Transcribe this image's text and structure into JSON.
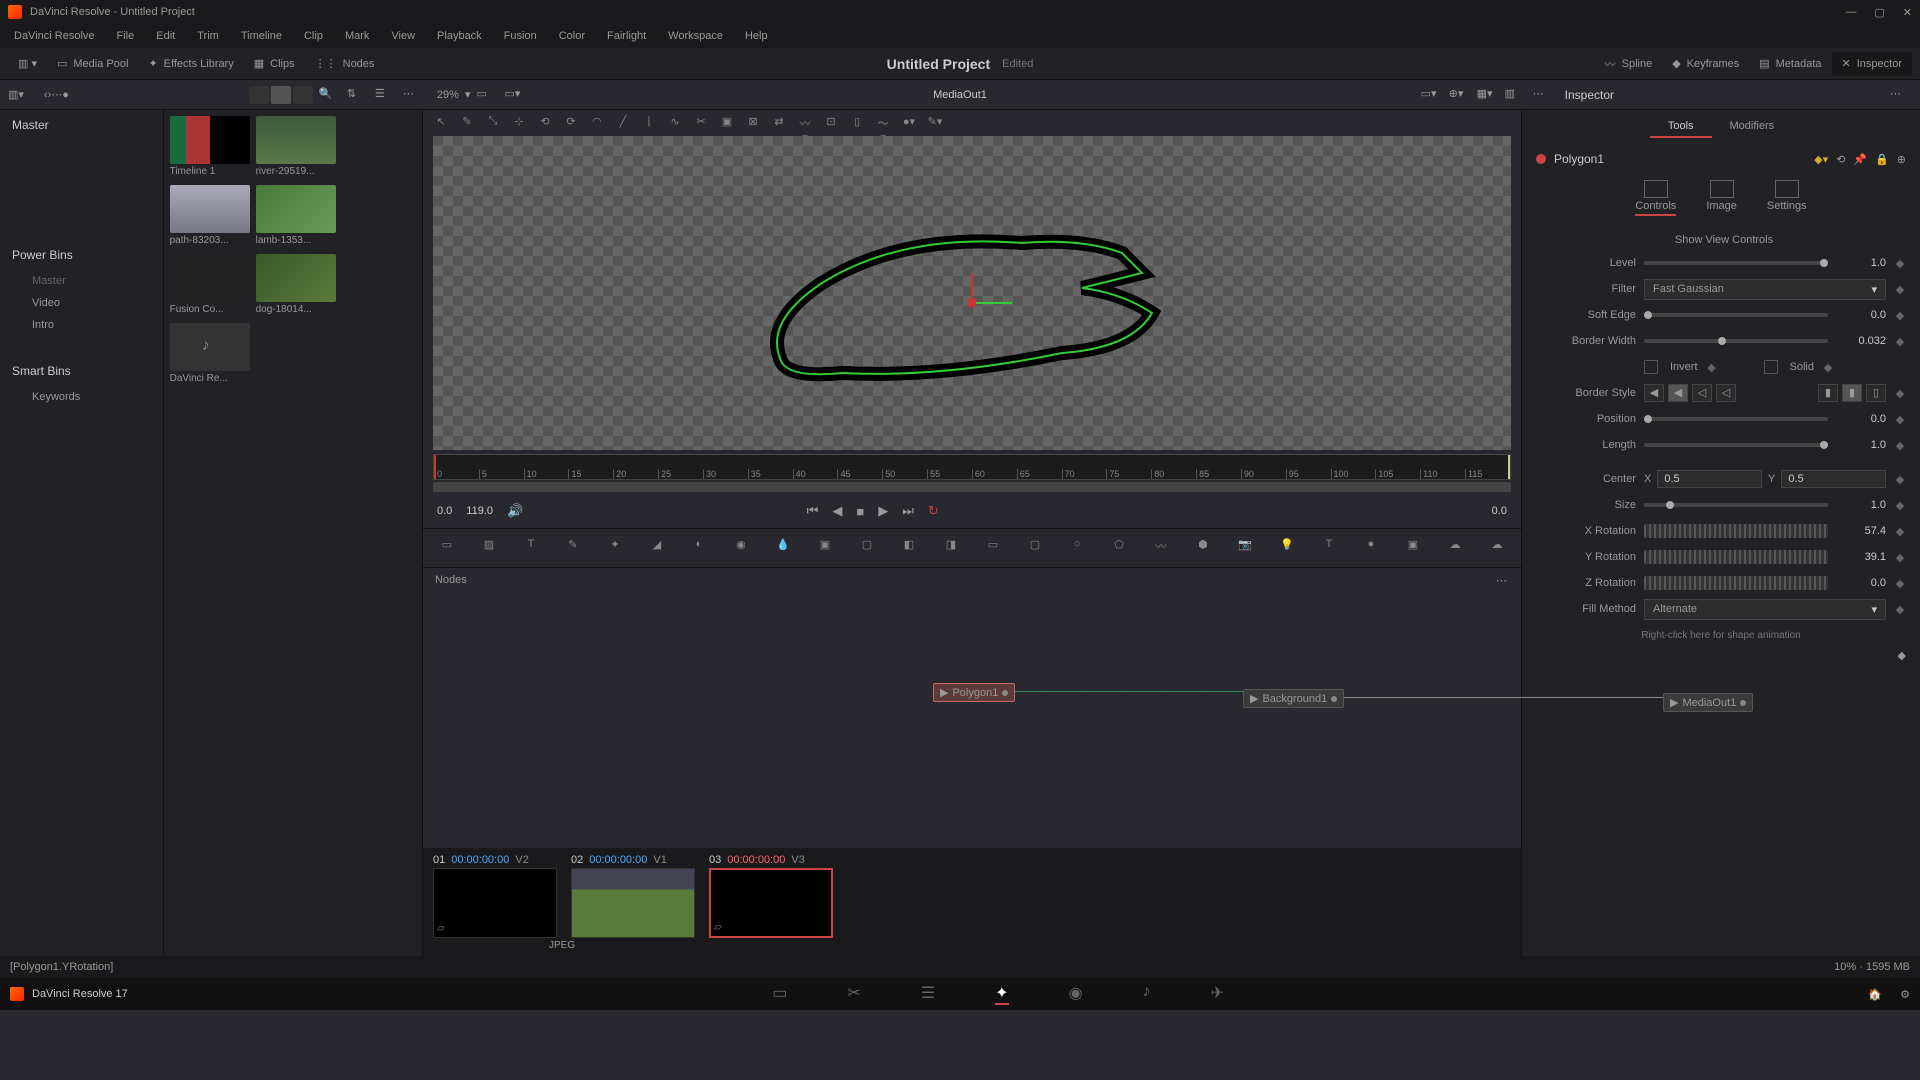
{
  "title": "DaVinci Resolve - Untitled Project",
  "menu": [
    "DaVinci Resolve",
    "File",
    "Edit",
    "Trim",
    "Timeline",
    "Clip",
    "Mark",
    "View",
    "Playback",
    "Fusion",
    "Color",
    "Fairlight",
    "Workspace",
    "Help"
  ],
  "toolbar": {
    "mediapool": "Media Pool",
    "effects": "Effects Library",
    "clips": "Clips",
    "nodes": "Nodes",
    "spline": "Spline",
    "keyframes": "Keyframes",
    "metadata": "Metadata",
    "inspector": "Inspector"
  },
  "project": {
    "name": "Untitled Project",
    "status": "Edited"
  },
  "subtoolbar": {
    "zoom": "29%",
    "viewer_name": "MediaOut1",
    "inspector": "Inspector"
  },
  "bins": {
    "master": "Master",
    "power": "Power Bins",
    "items": [
      "Master",
      "Video",
      "Intro"
    ],
    "smart": "Smart Bins",
    "keywords": "Keywords"
  },
  "thumbs": [
    {
      "label": "Timeline 1",
      "cls": "timeline"
    },
    {
      "label": "river-29519...",
      "cls": "river"
    },
    {
      "label": "path-83203...",
      "cls": "path"
    },
    {
      "label": "lamb-1353...",
      "cls": "lamb"
    },
    {
      "label": "Fusion Co...",
      "cls": "fusion"
    },
    {
      "label": "dog-18014...",
      "cls": "dog"
    },
    {
      "label": "DaVinci Re...",
      "cls": "audio"
    }
  ],
  "ruler": [
    "0",
    "5",
    "10",
    "15",
    "20",
    "25",
    "30",
    "35",
    "40",
    "45",
    "50",
    "55",
    "60",
    "65",
    "70",
    "75",
    "80",
    "85",
    "90",
    "95",
    "100",
    "105",
    "110",
    "115"
  ],
  "transport": {
    "left": "0.0",
    "dur": "119.0",
    "right": "0.0"
  },
  "nodes_title": "Nodes",
  "nodes": {
    "poly": "Polygon1",
    "bg": "Background1",
    "out": "MediaOut1"
  },
  "clips": [
    {
      "n": "01",
      "t": "00:00:00:00",
      "v": "V2",
      "cls": "",
      "sel": false,
      "red": false
    },
    {
      "n": "02",
      "t": "00:00:00:00",
      "v": "V1",
      "cls": "path",
      "sel": false,
      "red": false
    },
    {
      "n": "03",
      "t": "00:00:00:00",
      "v": "V3",
      "cls": "",
      "sel": true,
      "red": true
    }
  ],
  "fmt": "JPEG",
  "statushint": "[Polygon1.YRotation]",
  "statusmem": "10% · 1595 MB",
  "footer_app": "DaVinci Resolve 17",
  "inspector": {
    "tabs": {
      "tools": "Tools",
      "modifiers": "Modifiers"
    },
    "node": "Polygon1",
    "subtabs": {
      "controls": "Controls",
      "image": "Image",
      "settings": "Settings"
    },
    "showview": "Show View Controls",
    "rows": {
      "level": {
        "label": "Level",
        "val": "1.0"
      },
      "filter": {
        "label": "Filter",
        "val": "Fast Gaussian"
      },
      "softedge": {
        "label": "Soft Edge",
        "val": "0.0"
      },
      "border": {
        "label": "Border Width",
        "val": "0.032"
      },
      "invert": "Invert",
      "solid": "Solid",
      "borderstyle": "Border Style",
      "position": {
        "label": "Position",
        "val": "0.0"
      },
      "length": {
        "label": "Length",
        "val": "1.0"
      },
      "center": {
        "label": "Center",
        "xl": "X",
        "x": "0.5",
        "yl": "Y",
        "y": "0.5"
      },
      "size": {
        "label": "Size",
        "val": "1.0"
      },
      "xrot": {
        "label": "X Rotation",
        "val": "57.4"
      },
      "yrot": {
        "label": "Y Rotation",
        "val": "39.1"
      },
      "zrot": {
        "label": "Z Rotation",
        "val": "0.0"
      },
      "fill": {
        "label": "Fill Method",
        "val": "Alternate"
      },
      "anim": "Right-click here for shape animation"
    }
  }
}
